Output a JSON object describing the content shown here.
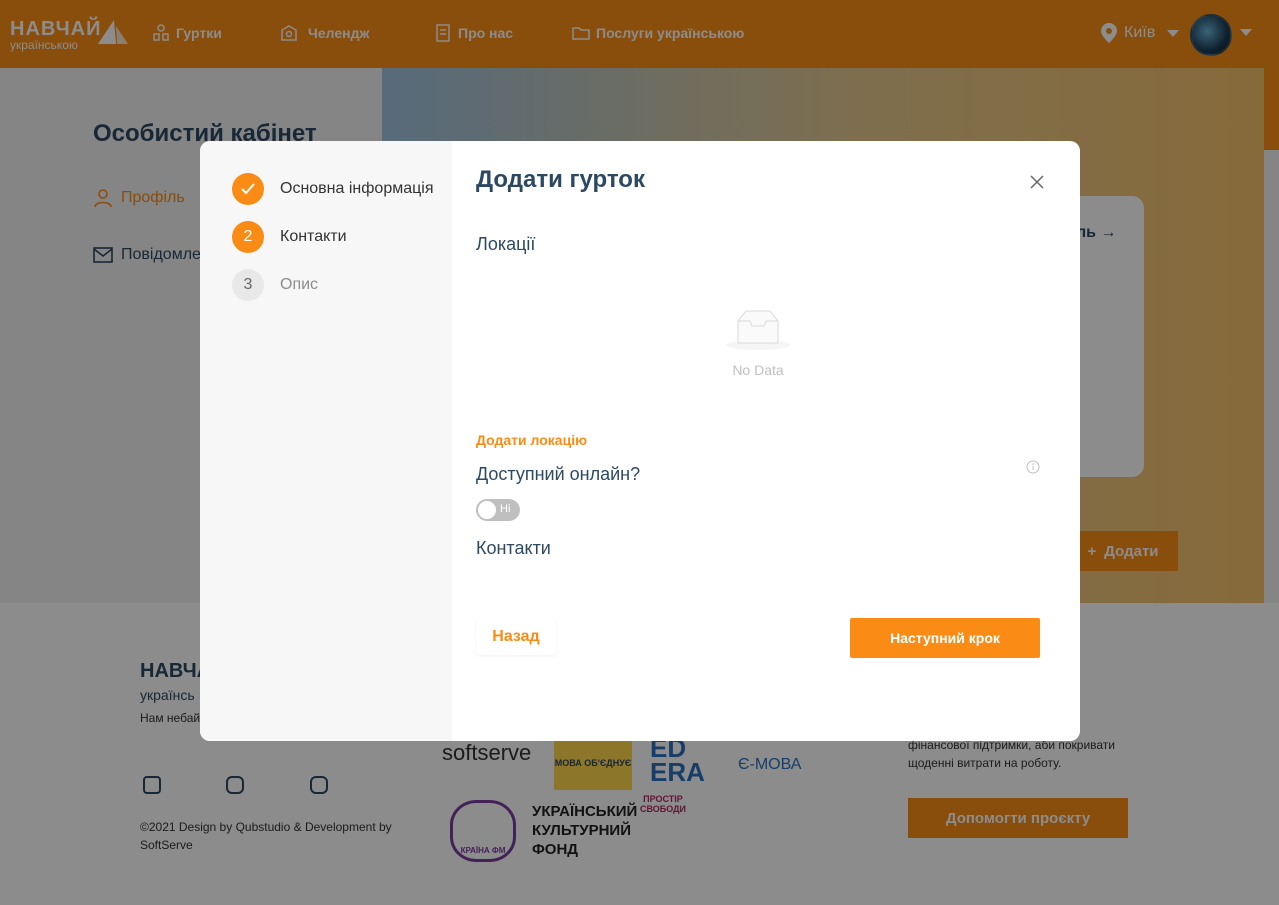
{
  "header": {
    "logo_line1": "НАВЧАЙ",
    "logo_line2": "українською",
    "nav": [
      {
        "label": "Гуртки",
        "icon": "clubs-icon"
      },
      {
        "label": "Челендж",
        "icon": "challenge-icon"
      },
      {
        "label": "Про нас",
        "icon": "about-icon"
      },
      {
        "label": "Послуги українською",
        "icon": "services-icon"
      }
    ],
    "city": "Київ"
  },
  "sidebar": {
    "title": "Особистий кабінет",
    "items": [
      {
        "label": "Профіль"
      },
      {
        "label": "Повідомле"
      }
    ]
  },
  "banner": {
    "card_link": "ль",
    "add_button": "Додати"
  },
  "footer": {
    "logo": "НАВЧА",
    "logo_sub": "українсь",
    "text": "Нам небай дітей та укр",
    "copyright": "©2021 Design by Qubstudio & Development by SoftServe",
    "partners": [
      "softserve",
      "МОВА ОБ'ЄДНУЄ",
      "ED ERA",
      "Є-МОВА",
      "КРАЇНА ФМ",
      "УКРАЇНСЬКИЙ КУЛЬТУРНИЙ ФОНД",
      "ПРОСТІР СВОБОДИ"
    ],
    "support_text": "фінансової підтримки, аби покривати щоденні витрати на роботу.",
    "donate_button": "Допомогти проєкту"
  },
  "modal": {
    "title": "Додати гурток",
    "steps": [
      {
        "number": "1",
        "label": "Основна інформація",
        "state": "done"
      },
      {
        "number": "2",
        "label": "Контакти",
        "state": "active"
      },
      {
        "number": "3",
        "label": "Опис",
        "state": "todo"
      }
    ],
    "locations_label": "Локації",
    "empty_text": "No Data",
    "add_location": "Додати локацію",
    "online_label": "Доступний онлайн?",
    "online_toggle": {
      "value": false,
      "text": "Ні"
    },
    "contacts_label": "Контакти",
    "back_button": "Назад",
    "next_button": "Наступний крок"
  },
  "colors": {
    "accent": "#fa8c16",
    "heading": "#2c4964",
    "overlay": "rgba(0,0,0,0.45)"
  }
}
